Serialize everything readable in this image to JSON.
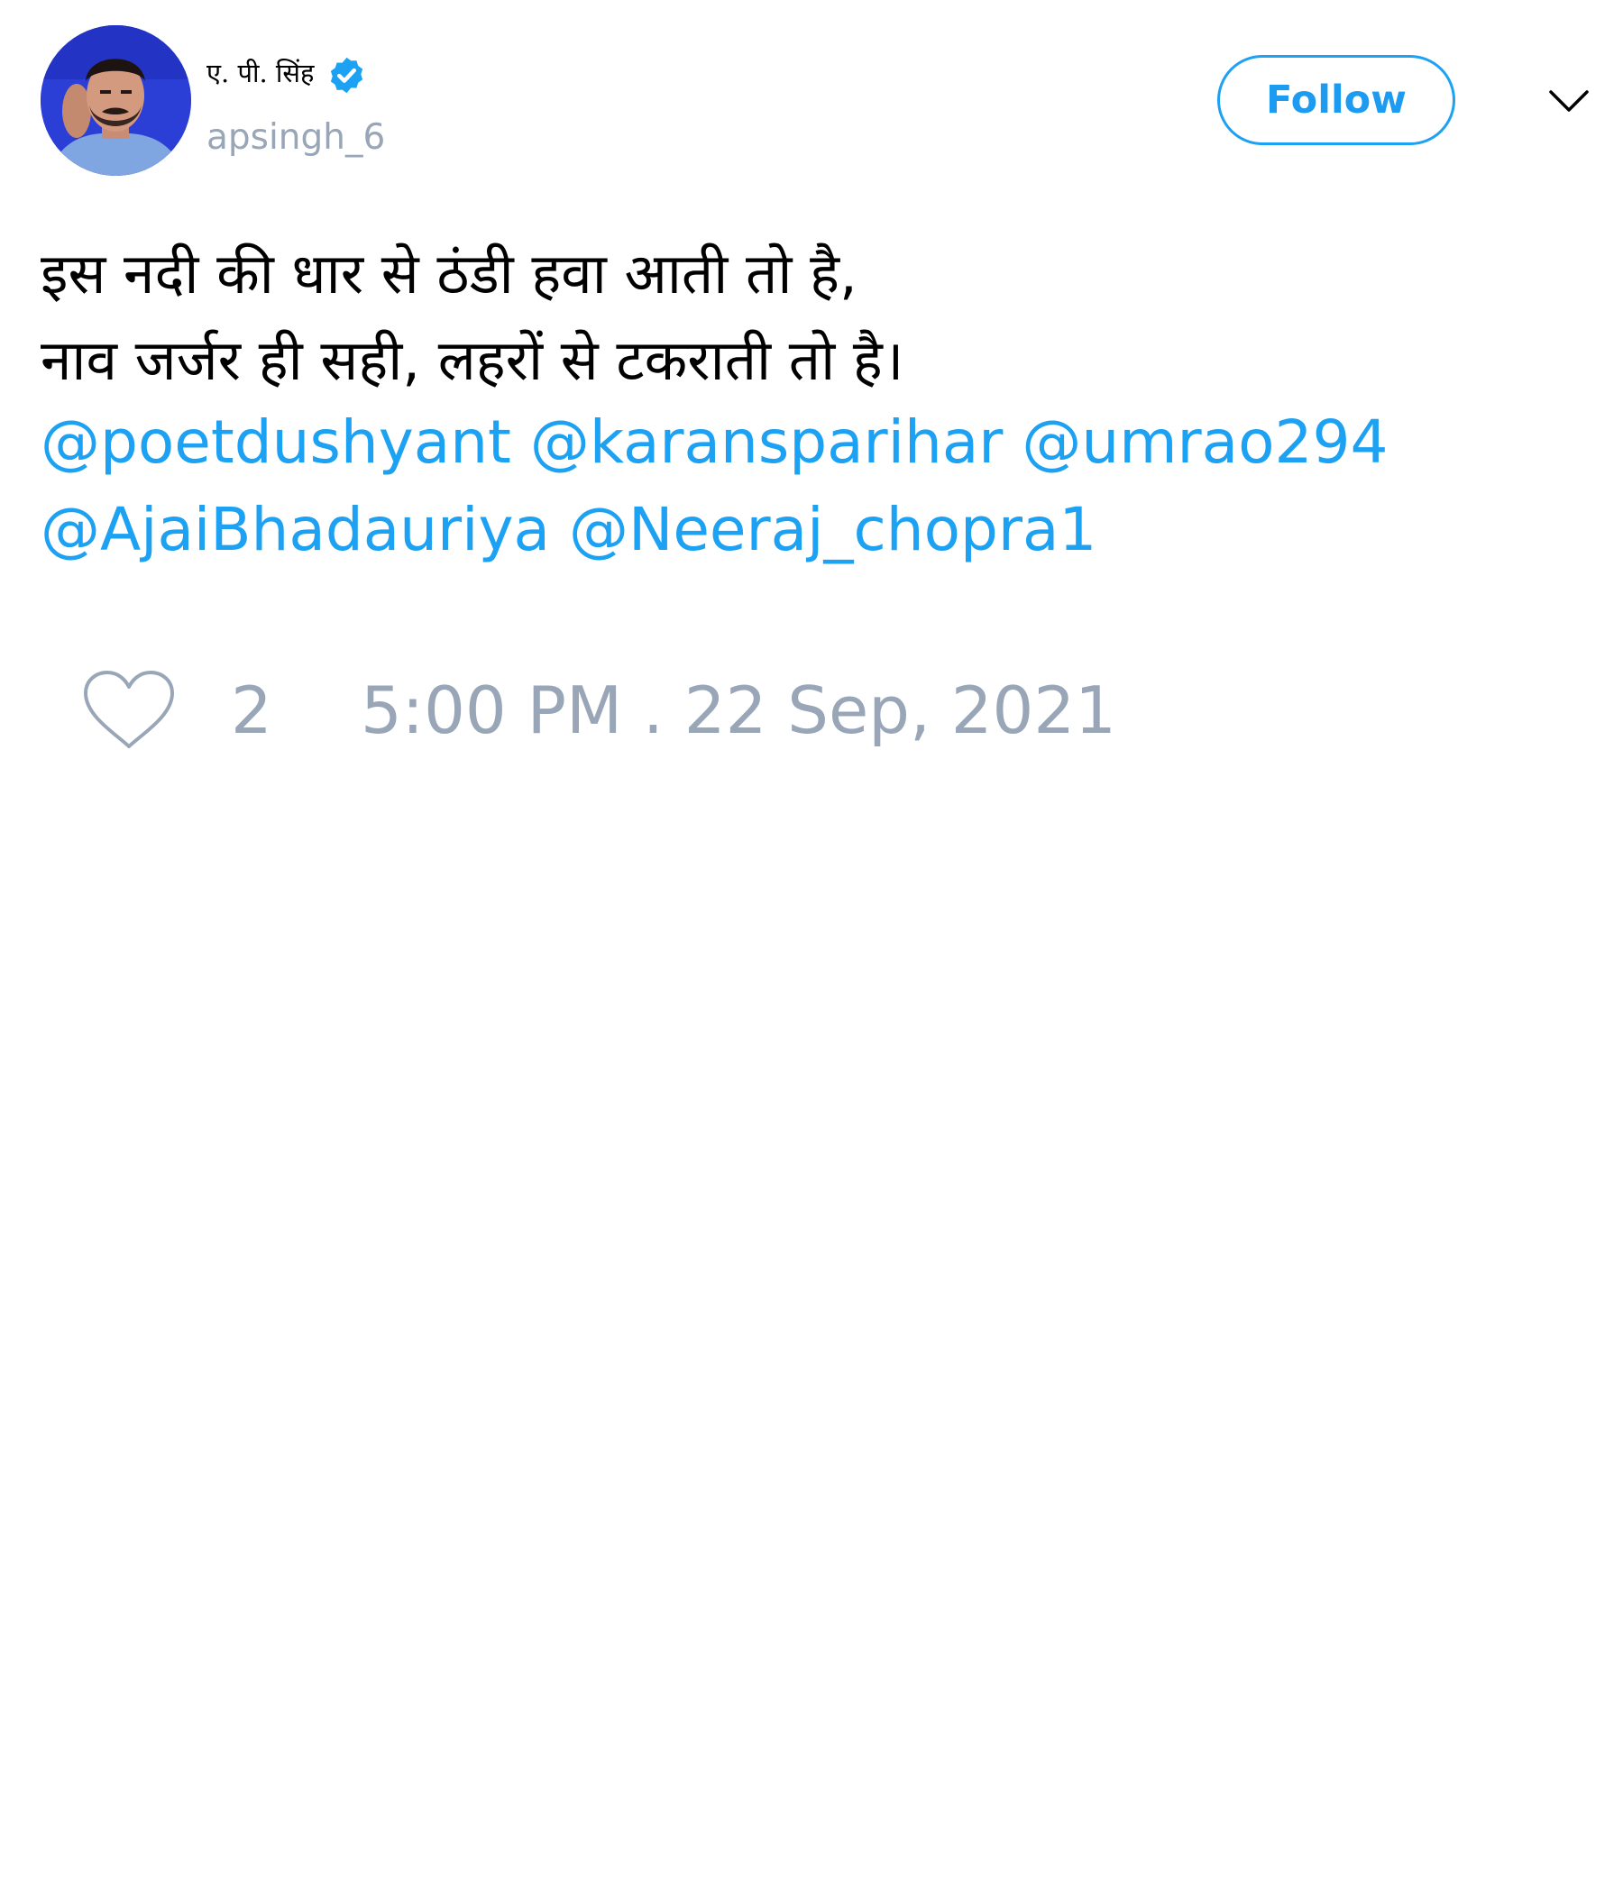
{
  "author": {
    "display_name": "ए. पी. सिंह",
    "handle": "apsingh_6",
    "verified": true,
    "avatar_icon": "profile-photo"
  },
  "header": {
    "follow_label": "Follow",
    "menu_icon": "chevron-down-icon"
  },
  "tweet": {
    "lines": [
      "इस नदी की धार से ठंडी हवा आती तो है,",
      "नाव जर्जर ही सही, लहरों से टकराती तो है।"
    ],
    "mentions": [
      "@poetdushyant",
      "@karansparihar",
      "@umrao294",
      "@AjaiBhadauriya",
      "@Neeraj_chopra1"
    ]
  },
  "footer": {
    "like_icon": "heart-icon",
    "like_count": "2",
    "timestamp": "5:00 PM . 22 Sep, 2021"
  },
  "colors": {
    "accent": "#1da1f2",
    "muted_text": "#99a6b7",
    "text": "#000000",
    "background": "#ffffff"
  }
}
